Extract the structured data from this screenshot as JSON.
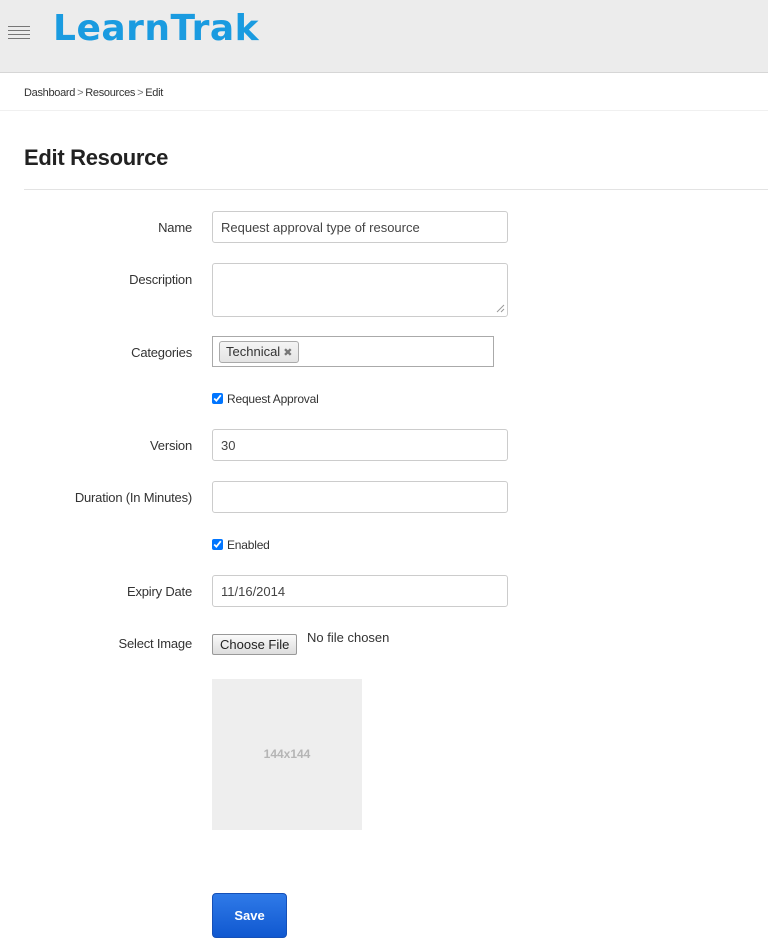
{
  "header": {
    "brand": "LearnTrak",
    "menu_icon": "hamburger-icon",
    "brand_color": "#1a9be0"
  },
  "breadcrumb": {
    "items": [
      "Dashboard",
      "Resources",
      "Edit"
    ],
    "separator": ">"
  },
  "page": {
    "title": "Edit Resource"
  },
  "form": {
    "name_label": "Name",
    "name_value": "Request approval type of resource",
    "description_label": "Description",
    "description_value": "",
    "categories_label": "Categories",
    "categories": [
      "Technical"
    ],
    "tag_remove_glyph": "✖",
    "request_approval_label": "Request Approval",
    "request_approval_checked": true,
    "version_label": "Version",
    "version_value": "30",
    "duration_label": "Duration (In Minutes)",
    "duration_value": "",
    "enabled_label": "Enabled",
    "enabled_checked": true,
    "expiry_label": "Expiry Date",
    "expiry_value": "11/16/2014",
    "image_label": "Select Image",
    "file_button": "Choose File",
    "file_status": "No file chosen",
    "thumbnail_placeholder": "144x144",
    "save_label": "Save",
    "save_color": "#1f6ae0"
  }
}
